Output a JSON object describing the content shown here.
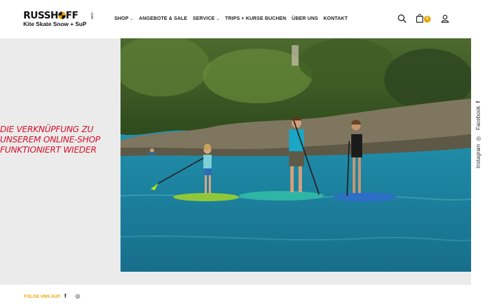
{
  "logo": {
    "main": "RUSSHOFF",
    "sub": "Kite Skate Snow + SuP",
    "com": ".com"
  },
  "nav": {
    "items": [
      {
        "label": "SHOP",
        "has_dropdown": true
      },
      {
        "label": "ANGEBOTE & SALE",
        "has_dropdown": false
      },
      {
        "label": "SERVICE",
        "has_dropdown": true
      },
      {
        "label": "TRIPS + KURSE BUCHEN",
        "has_dropdown": false
      },
      {
        "label": "ÜBER UNS",
        "has_dropdown": false
      },
      {
        "label": "KONTAKT",
        "has_dropdown": false
      }
    ]
  },
  "header_icons": {
    "search": "search-icon",
    "cart": "cart-icon",
    "cart_count": "0",
    "account": "user-icon"
  },
  "hero": {
    "message_line1": "DIE VERKNÜPFUNG ZU",
    "message_line2": "UNSEREM ONLINE-SHOP",
    "message_line3": "FUNKTIONIERT WIEDER",
    "image_description": "photo"
  },
  "social_rail": {
    "facebook": "Facebook",
    "instagram": "Instagram"
  },
  "footer": {
    "follow_label": "FOLGE UNS AUF:"
  },
  "colors": {
    "accent": "#e8a400",
    "headline_red": "#d6102a",
    "panel_grey": "#ebebeb"
  }
}
